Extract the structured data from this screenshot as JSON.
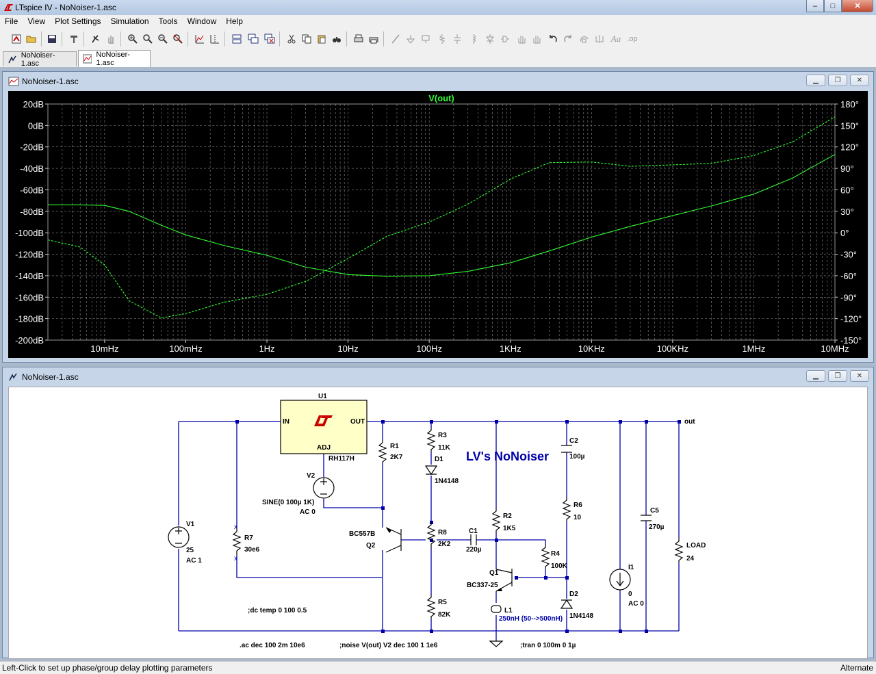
{
  "window": {
    "title": "LTspice IV - NoNoiser-1.asc",
    "min": "–",
    "max": "□",
    "close": "✕"
  },
  "menu": [
    "File",
    "View",
    "Plot Settings",
    "Simulation",
    "Tools",
    "Window",
    "Help"
  ],
  "tabs": [
    {
      "label": "NoNoiser-1.asc",
      "active": false
    },
    {
      "label": "NoNoiser-1.asc",
      "active": true
    }
  ],
  "plot_window": {
    "title": "NoNoiser-1.asc"
  },
  "schematic_window": {
    "title": "NoNoiser-1.asc"
  },
  "chart_data": {
    "type": "line",
    "title": "V(out)",
    "xlabel": "",
    "ylabel": "",
    "x_scale": "log",
    "xlim": [
      0.002,
      10000000
    ],
    "ylim": [
      -200,
      20
    ],
    "y2lim": [
      -150,
      180
    ],
    "x_ticks": [
      "10mHz",
      "100mHz",
      "1Hz",
      "10Hz",
      "100Hz",
      "1KHz",
      "10KHz",
      "100KHz",
      "1MHz",
      "10MHz"
    ],
    "y_ticks": [
      "20dB",
      "0dB",
      "-20dB",
      "-40dB",
      "-60dB",
      "-80dB",
      "-100dB",
      "-120dB",
      "-140dB",
      "-160dB",
      "-180dB",
      "-200dB"
    ],
    "y2_ticks": [
      "180°",
      "150°",
      "120°",
      "90°",
      "60°",
      "30°",
      "0°",
      "-30°",
      "-60°",
      "-90°",
      "-120°",
      "-150°"
    ],
    "grid": true,
    "background": "#000000",
    "series": [
      {
        "kind": "magnitude",
        "color": "#33ff33",
        "style": "solid",
        "x": [
          0.002,
          0.005,
          0.01,
          0.02,
          0.05,
          0.1,
          0.3,
          1,
          3,
          10,
          30,
          100,
          300,
          1000,
          3000,
          10000,
          30000,
          100000,
          300000,
          1000000,
          3000000,
          10000000
        ],
        "y": [
          -74,
          -74,
          -74.5,
          -80,
          -93,
          -102,
          -112,
          -121,
          -132,
          -139,
          -140.5,
          -140,
          -136,
          -128,
          -117,
          -104,
          -94,
          -84,
          -75,
          -64,
          -49,
          -27
        ]
      },
      {
        "kind": "phase",
        "color": "#33ff33",
        "style": "dashed",
        "x": [
          0.002,
          0.005,
          0.01,
          0.02,
          0.05,
          0.1,
          0.3,
          1,
          3,
          10,
          30,
          100,
          300,
          1000,
          3000,
          10000,
          30000,
          100000,
          300000,
          1000000,
          3000000,
          10000000
        ],
        "y": [
          -10,
          -20,
          -45,
          -95,
          -119,
          -113,
          -97,
          -86,
          -68,
          -36,
          -5,
          15,
          40,
          75,
          98,
          99,
          93,
          95,
          97,
          108,
          127,
          162
        ]
      }
    ]
  },
  "schematic": {
    "title_text": "LV's NoNoiser",
    "colors": {
      "wire": "#0000aa",
      "component": "#000000",
      "text": "#000000",
      "accent": "#cc0000"
    },
    "labels": {
      "u1": "U1",
      "u1_in": "IN",
      "u1_out": "OUT",
      "u1_adj": "ADJ",
      "u1_part": "RH117H",
      "v2": "V2",
      "v2_val": "SINE(0 100µ 1K)",
      "v2_ac": "AC 0",
      "v1": "V1",
      "v1_val": "25",
      "v1_ac": "AC 1",
      "r7": "R7",
      "r7_val": "30e6",
      "r1": "R1",
      "r1_val": "2K7",
      "r3": "R3",
      "r3_val": "11K",
      "d1": "D1",
      "d1_val": "1N4148",
      "r8": "R8",
      "r8_val": "2K2",
      "c1": "C1",
      "c1_val": "220µ",
      "r5": "R5",
      "r5_val": "82K",
      "q2": "Q2",
      "q2_part": "BC557B",
      "r2": "R2",
      "r2_val": "1K5",
      "q1": "Q1",
      "q1_part": "BC337-25",
      "l1": "L1",
      "l1_val": "250nH (50-->500nH)",
      "c2": "C2",
      "c2_val": "100µ",
      "r6": "R6",
      "r6_val": "10",
      "r4": "R4",
      "r4_val": "100K",
      "d2": "D2",
      "d2_val": "1N4148",
      "i1": "I1",
      "i1_val": "0",
      "i1_ac": "AC 0",
      "c5": "C5",
      "c5_val": "270µ",
      "load": "LOAD",
      "load_val": "24",
      "net_out": "out",
      "dir_dc": ";dc temp 0 100 0.5",
      "dir_ac": ".ac dec 100 2m 10e6",
      "dir_noise": ";noise V(out) V2 dec 100 1 1e6",
      "dir_tran": ";tran 0 100m 0 1µ"
    }
  },
  "status": {
    "left": "Left-Click to set up phase/group delay plotting parameters",
    "right": "Alternate"
  }
}
